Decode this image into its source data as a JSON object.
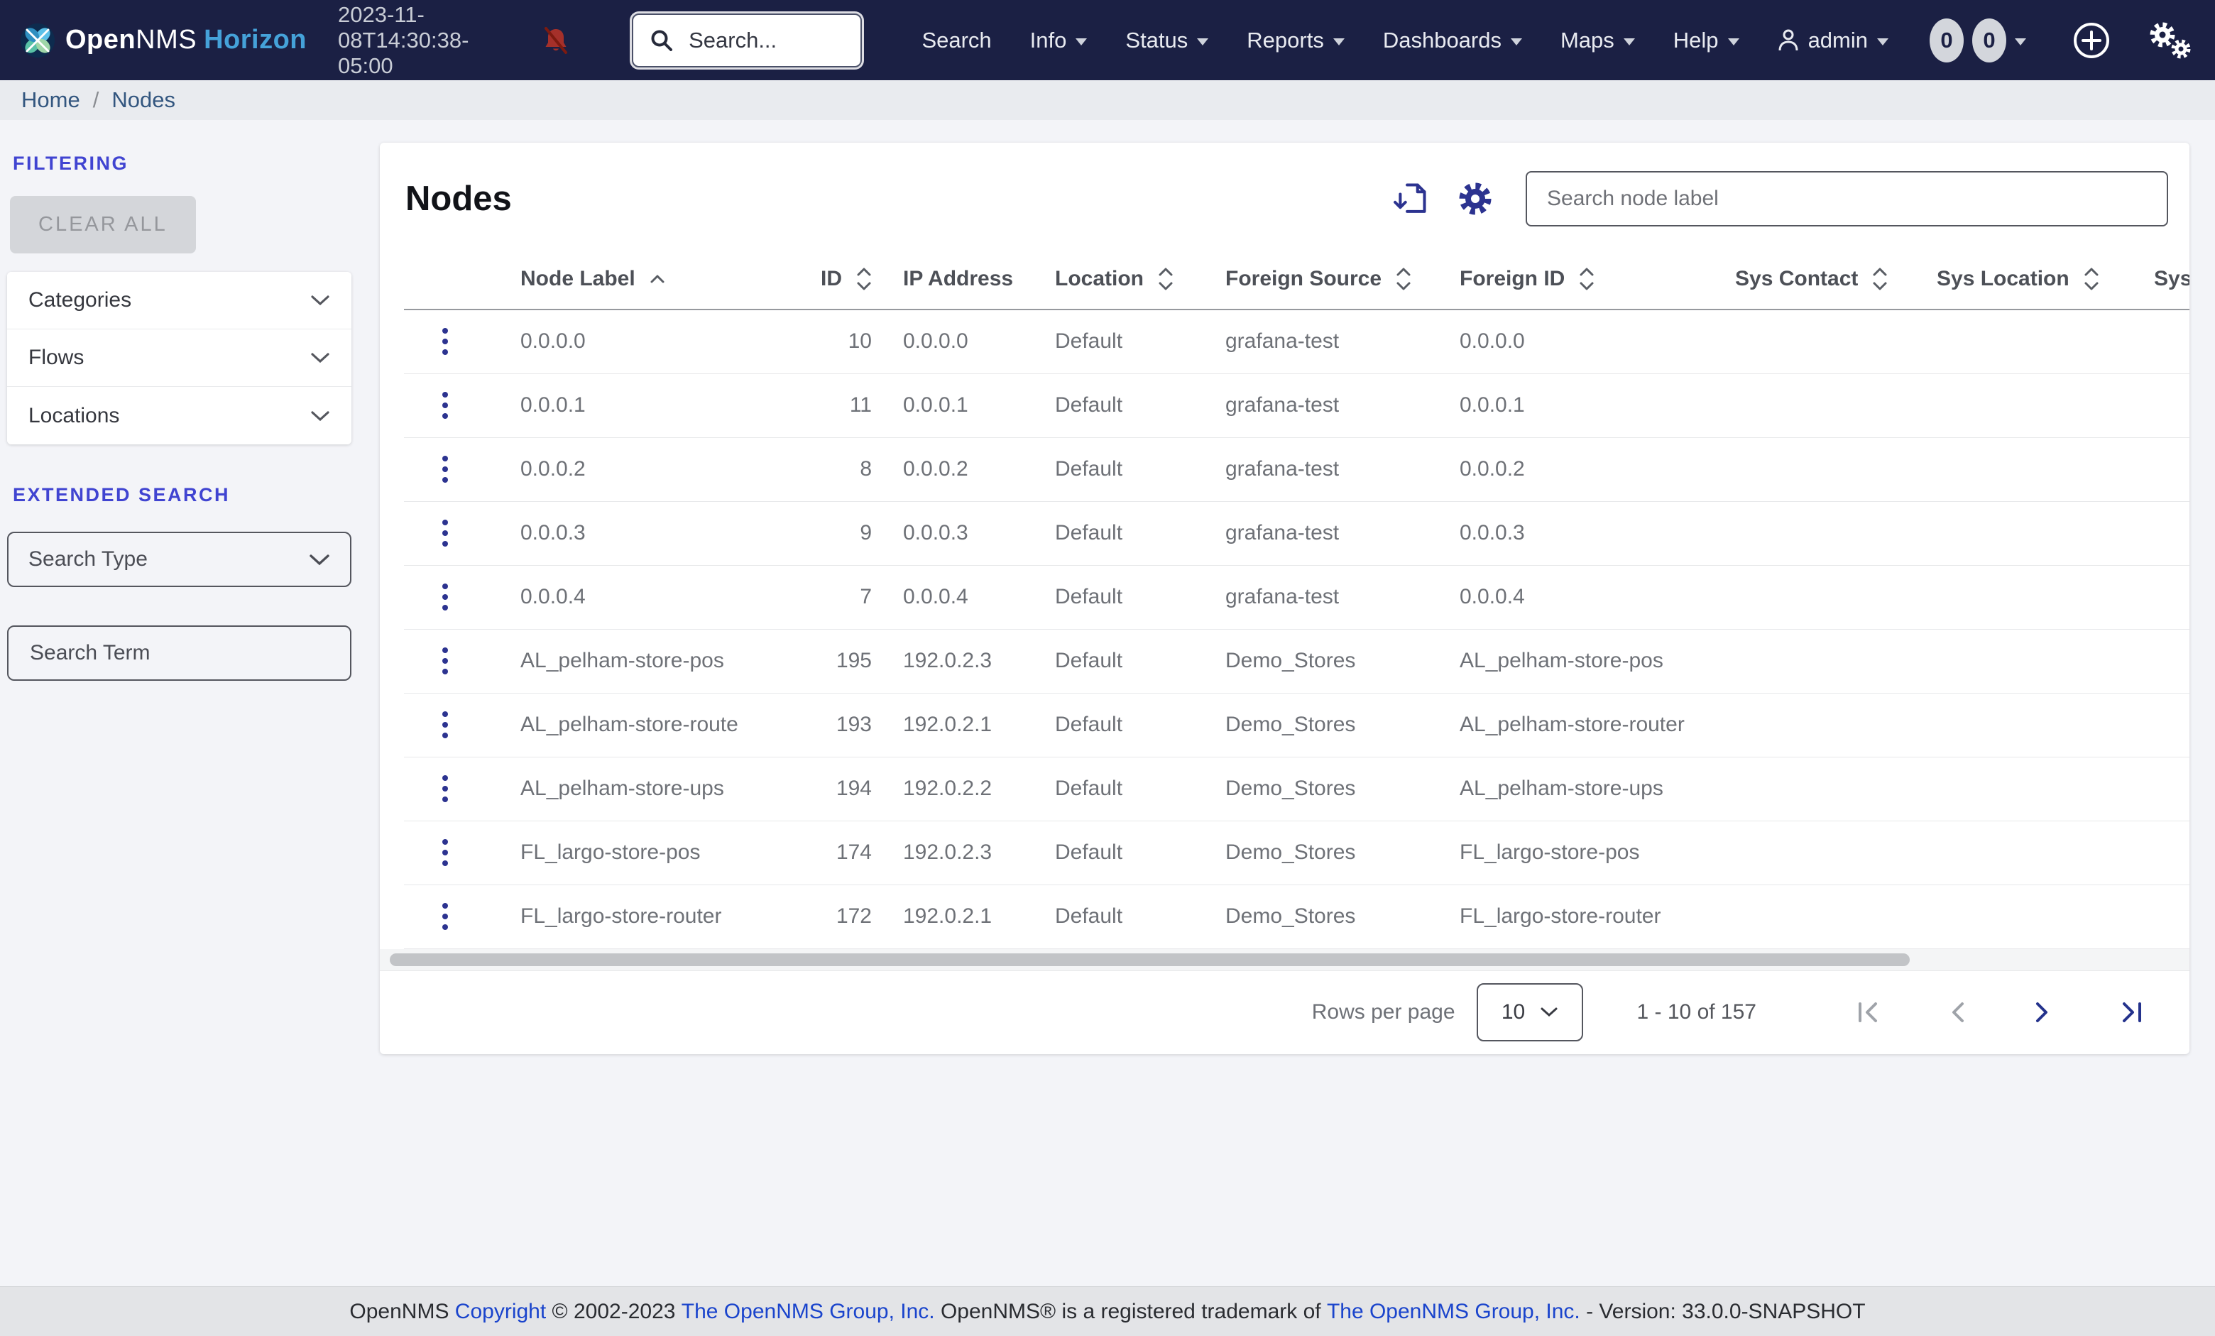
{
  "navbar": {
    "brand": {
      "name_bold": "Open",
      "name_rest": "NMS",
      "product": "Horizon"
    },
    "timestamp": "2023-11-08T14:30:38-05:00",
    "search_placeholder": "Search...",
    "menu": [
      {
        "label": "Search",
        "caret": false
      },
      {
        "label": "Info",
        "caret": true
      },
      {
        "label": "Status",
        "caret": true
      },
      {
        "label": "Reports",
        "caret": true
      },
      {
        "label": "Dashboards",
        "caret": true
      },
      {
        "label": "Maps",
        "caret": true
      },
      {
        "label": "Help",
        "caret": true
      },
      {
        "label": "admin",
        "caret": true,
        "icon": "person"
      }
    ],
    "badges": [
      "0",
      "0"
    ]
  },
  "breadcrumb": {
    "items": [
      "Home",
      "Nodes"
    ],
    "separator": "/"
  },
  "sidebar": {
    "filtering_label": "FILTERING",
    "clear_all_label": "CLEAR ALL",
    "accordions": [
      "Categories",
      "Flows",
      "Locations"
    ],
    "extended_search_label": "EXTENDED SEARCH",
    "search_type_placeholder": "Search Type",
    "search_term_placeholder": "Search Term"
  },
  "main": {
    "title": "Nodes",
    "search_placeholder": "Search node label",
    "table": {
      "columns": [
        {
          "label": "Node Label",
          "sort": "asc"
        },
        {
          "label": "ID",
          "sort": "both"
        },
        {
          "label": "IP Address",
          "sort": "none"
        },
        {
          "label": "Location",
          "sort": "both"
        },
        {
          "label": "Foreign Source",
          "sort": "both"
        },
        {
          "label": "Foreign ID",
          "sort": "both"
        },
        {
          "label": "Sys Contact",
          "sort": "both"
        },
        {
          "label": "Sys Location",
          "sort": "both"
        },
        {
          "label": "Sys Description",
          "sort": "both"
        }
      ],
      "rows": [
        {
          "label": {
            "t": "0.0.0.0",
            "c": "red"
          },
          "id": {
            "t": "10",
            "c": "red"
          },
          "ip": {
            "t": "0.0.0.0",
            "c": "red"
          },
          "location": "Default",
          "foreign_source": "grafana-test",
          "foreign_id": "0.0.0.0",
          "sys_contact": "",
          "sys_location": "",
          "sys_description": ""
        },
        {
          "label": {
            "t": "0.0.0.1",
            "c": "blue"
          },
          "id": {
            "t": "11",
            "c": "blue"
          },
          "ip": {
            "t": "0.0.0.1",
            "c": "blue"
          },
          "location": "Default",
          "foreign_source": "grafana-test",
          "foreign_id": "0.0.0.1",
          "sys_contact": "",
          "sys_location": "",
          "sys_description": ""
        },
        {
          "label": {
            "t": "0.0.0.2",
            "c": "red"
          },
          "id": {
            "t": "8",
            "c": "red"
          },
          "ip": {
            "t": "0.0.0.2",
            "c": "red"
          },
          "location": "Default",
          "foreign_source": "grafana-test",
          "foreign_id": "0.0.0.2",
          "sys_contact": "",
          "sys_location": "",
          "sys_description": ""
        },
        {
          "label": {
            "t": "0.0.0.3",
            "c": "red"
          },
          "id": {
            "t": "9",
            "c": "red"
          },
          "ip": {
            "t": "0.0.0.3",
            "c": "red"
          },
          "location": "Default",
          "foreign_source": "grafana-test",
          "foreign_id": "0.0.0.3",
          "sys_contact": "",
          "sys_location": "",
          "sys_description": ""
        },
        {
          "label": {
            "t": "0.0.0.4",
            "c": "red"
          },
          "id": {
            "t": "7",
            "c": "red"
          },
          "ip": {
            "t": "0.0.0.4",
            "c": "blue"
          },
          "location": "Default",
          "foreign_source": "grafana-test",
          "foreign_id": "0.0.0.4",
          "sys_contact": "",
          "sys_location": "",
          "sys_description": ""
        },
        {
          "label": {
            "t": "AL_pelham-store-pos",
            "c": "red"
          },
          "id": {
            "t": "195",
            "c": "red"
          },
          "ip": {
            "t": "192.0.2.3",
            "c": "blue"
          },
          "location": "Default",
          "foreign_source": "Demo_Stores",
          "foreign_id": "AL_pelham-store-pos",
          "sys_contact": "",
          "sys_location": "",
          "sys_description": ""
        },
        {
          "label": {
            "t": "AL_pelham-store-router",
            "c": "red"
          },
          "id": {
            "t": "193",
            "c": "red"
          },
          "ip": {
            "t": "192.0.2.1",
            "c": "blue"
          },
          "location": "Default",
          "foreign_source": "Demo_Stores",
          "foreign_id": "AL_pelham-store-router",
          "sys_contact": "",
          "sys_location": "",
          "sys_description": ""
        },
        {
          "label": {
            "t": "AL_pelham-store-ups",
            "c": "red"
          },
          "id": {
            "t": "194",
            "c": "red"
          },
          "ip": {
            "t": "192.0.2.2",
            "c": "blue"
          },
          "location": "Default",
          "foreign_source": "Demo_Stores",
          "foreign_id": "AL_pelham-store-ups",
          "sys_contact": "",
          "sys_location": "",
          "sys_description": ""
        },
        {
          "label": {
            "t": "FL_largo-store-pos",
            "c": "blue"
          },
          "id": {
            "t": "174",
            "c": "blue"
          },
          "ip": {
            "t": "192.0.2.3",
            "c": "red"
          },
          "location": "Default",
          "foreign_source": "Demo_Stores",
          "foreign_id": "FL_largo-store-pos",
          "sys_contact": "",
          "sys_location": "",
          "sys_description": ""
        },
        {
          "label": {
            "t": "FL_largo-store-router",
            "c": "blue"
          },
          "id": {
            "t": "172",
            "c": "blue"
          },
          "ip": {
            "t": "192.0.2.1",
            "c": "blue"
          },
          "location": "Default",
          "foreign_source": "Demo_Stores",
          "foreign_id": "FL_largo-store-router",
          "sys_contact": "",
          "sys_location": "",
          "sys_description": ""
        }
      ]
    },
    "pagination": {
      "rows_per_page_label": "Rows per page",
      "page_size": "10",
      "range": "1 - 10 of 157"
    }
  },
  "footer": {
    "segments": [
      {
        "text": "OpenNMS ",
        "link": false
      },
      {
        "text": "Copyright",
        "link": true
      },
      {
        "text": " © 2002-2023 ",
        "link": false
      },
      {
        "text": "The OpenNMS Group, Inc.",
        "link": true
      },
      {
        "text": " OpenNMS® is a registered trademark of ",
        "link": false
      },
      {
        "text": "The OpenNMS Group, Inc.",
        "link": true
      },
      {
        "text": " - Version: 33.0.0-SNAPSHOT",
        "link": false
      }
    ]
  },
  "colors": {
    "navbar_bg": "#1b2044",
    "brand_product": "#45a2d9",
    "section_heading": "#4044d1",
    "accent_indigo": "#2c3390",
    "link_red": "#7d1a10",
    "link_blue": "#1c3dd3",
    "breadcrumb_link": "#33567f",
    "alert_bell": "#a5302a"
  }
}
